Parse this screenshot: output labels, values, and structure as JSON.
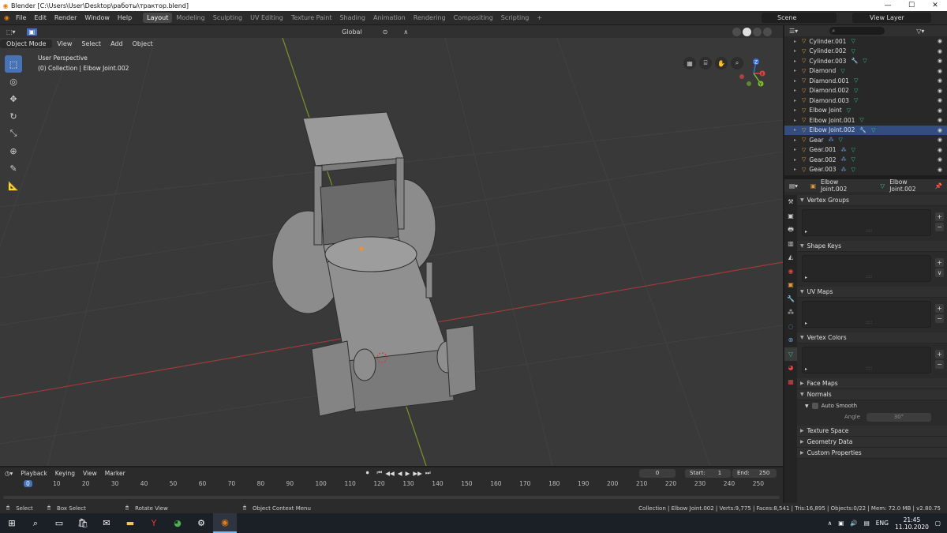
{
  "window": {
    "title": "Blender [C:\\Users\\User\\Desktop\\работы\\трактор.blend]",
    "controls": [
      "—",
      "☐",
      "✕"
    ]
  },
  "menu": [
    "File",
    "Edit",
    "Render",
    "Window",
    "Help"
  ],
  "workspaces": [
    "Layout",
    "Modeling",
    "Sculpting",
    "UV Editing",
    "Texture Paint",
    "Shading",
    "Animation",
    "Rendering",
    "Compositing",
    "Scripting"
  ],
  "active_workspace": "Layout",
  "scene": "Scene",
  "view_layer": "View Layer",
  "viewport": {
    "orientation": "Global",
    "mode": "Object Mode",
    "header_menus": [
      "View",
      "Select",
      "Add",
      "Object"
    ],
    "overlay_line1": "User Perspective",
    "overlay_line2": "(0) Collection | Elbow Joint.002",
    "gizmo_axes": [
      "X",
      "Y",
      "Z"
    ],
    "colors": {
      "bg": "#393939",
      "grid": "#444444",
      "x_axis": "#a83b3b",
      "y_axis": "#7f9a2a",
      "accent": "#4772b3"
    }
  },
  "outliner": {
    "search_placeholder": "",
    "rows": [
      {
        "name": "Cylinder.001",
        "extra": "mesh"
      },
      {
        "name": "Cylinder.002",
        "extra": "mesh"
      },
      {
        "name": "Cylinder.003",
        "extra": "wrench+mesh"
      },
      {
        "name": "Diamond",
        "extra": "mesh"
      },
      {
        "name": "Diamond.001",
        "extra": "mesh"
      },
      {
        "name": "Diamond.002",
        "extra": "mesh"
      },
      {
        "name": "Diamond.003",
        "extra": "mesh"
      },
      {
        "name": "Elbow Joint",
        "extra": "mesh"
      },
      {
        "name": "Elbow Joint.001",
        "extra": "mesh"
      },
      {
        "name": "Elbow Joint.002",
        "extra": "wrench+mesh",
        "selected": true
      },
      {
        "name": "Gear",
        "extra": "mod+mesh"
      },
      {
        "name": "Gear.001",
        "extra": "mod+mesh"
      },
      {
        "name": "Gear.002",
        "extra": "mod+mesh"
      },
      {
        "name": "Gear.003",
        "extra": "mod+mesh"
      }
    ]
  },
  "properties": {
    "object_name": "Elbow Joint.002",
    "data_name": "Elbow Joint.002",
    "panels": [
      "Vertex Groups",
      "Shape Keys",
      "UV Maps",
      "Vertex Colors"
    ],
    "collapsed_panels": [
      "Face Maps",
      "Normals"
    ],
    "auto_smooth_label": "Auto Smooth",
    "angle_label": "Angle",
    "angle_value": "30°",
    "bottom_panels": [
      "Texture Space",
      "Geometry Data",
      "Custom Properties"
    ]
  },
  "timeline": {
    "menus": [
      "Playback",
      "Keying",
      "View",
      "Marker"
    ],
    "current_frame": "0",
    "start_label": "Start:",
    "start": "1",
    "end_label": "End:",
    "end": "250",
    "ticks": [
      "0",
      "10",
      "20",
      "30",
      "40",
      "50",
      "60",
      "70",
      "80",
      "90",
      "100",
      "110",
      "120",
      "130",
      "140",
      "150",
      "160",
      "170",
      "180",
      "190",
      "200",
      "210",
      "220",
      "230",
      "240",
      "250"
    ]
  },
  "status": {
    "select": "Select",
    "box_select": "Box Select",
    "rotate_view": "Rotate View",
    "context_menu": "Object Context Menu",
    "stats": "Collection | Elbow Joint.002 | Verts:9,775 | Faces:8,541 | Tris:16,895 | Objects:0/22 | Mem: 72.0 MB | v2.80.75"
  },
  "taskbar": {
    "language": "ENG",
    "time": "21:45",
    "date": "11.10.2020"
  }
}
